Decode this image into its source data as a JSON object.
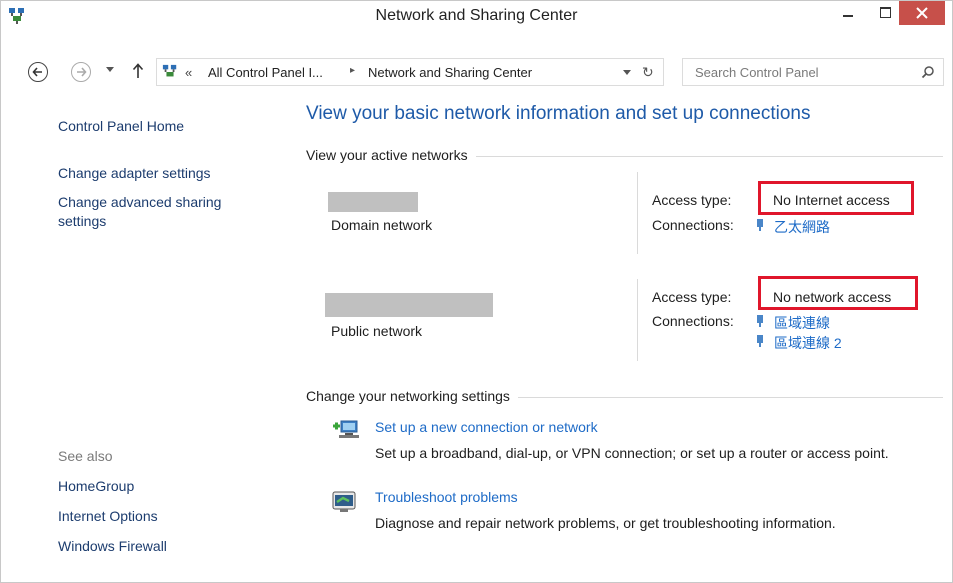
{
  "window": {
    "title": "Network and Sharing Center"
  },
  "address": {
    "prefix": "«",
    "crumbs": [
      "All Control Panel I...",
      "Network and Sharing Center"
    ],
    "separator": "▸"
  },
  "search": {
    "placeholder": "Search Control Panel"
  },
  "sidebar": {
    "home": "Control Panel Home",
    "links": [
      "Change adapter settings",
      "Change advanced sharing",
      "settings"
    ],
    "see_also_label": "See also",
    "see_also": [
      "HomeGroup",
      "Internet Options",
      "Windows Firewall"
    ]
  },
  "main": {
    "title": "View your basic network information and set up connections",
    "active_networks_heading": "View your active networks",
    "labels": {
      "access_type": "Access type:",
      "connections": "Connections:"
    },
    "networks": [
      {
        "type": "Domain network",
        "access": "No Internet access",
        "connections": [
          "乙太網路"
        ]
      },
      {
        "type": "Public network",
        "access": "No network access",
        "connections": [
          "區域連線",
          "區域連線 2"
        ]
      }
    ],
    "settings_heading": "Change your networking settings",
    "tasks": [
      {
        "title": "Set up a new connection or network",
        "description": "Set up a broadband, dial-up, or VPN connection; or set up a router or access point.",
        "icon": "network-setup-icon"
      },
      {
        "title": "Troubleshoot problems",
        "description": "Diagnose and repair network problems, or get troubleshooting information.",
        "icon": "troubleshoot-icon"
      }
    ]
  },
  "colors": {
    "link": "#1e6bc7",
    "title": "#1e5aa8",
    "highlight": "#e0162b",
    "close_button": "#c7504a"
  }
}
